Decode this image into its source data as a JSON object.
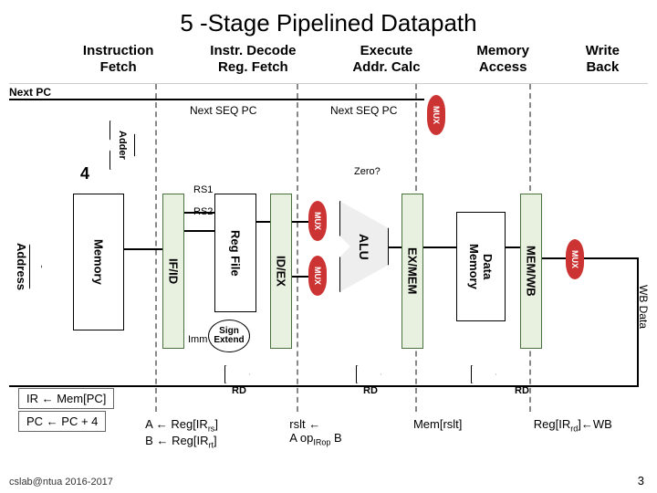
{
  "title": "5 -Stage Pipelined Datapath",
  "stages": {
    "if": "Instruction\nFetch",
    "id": "Instr. Decode\nReg. Fetch",
    "ex": "Execute\nAddr. Calc",
    "mem": "Memory\nAccess",
    "wb": "Write\nBack"
  },
  "labels": {
    "next_pc": "Next PC",
    "next_seq_pc": "Next SEQ PC",
    "adder": "Adder",
    "four": "4",
    "address": "Address",
    "memory": "Memory",
    "pipe_ifid": "IF/ID",
    "pipe_idex": "ID/EX",
    "pipe_exmem": "EX/MEM",
    "pipe_memwb": "MEM/WB",
    "rs1": "RS1",
    "rs2": "RS2",
    "regfile": "Reg File",
    "zero": "Zero?",
    "alu": "ALU",
    "mux": "MUX",
    "data_memory": "Data\nMemory",
    "sign_extend": "Sign\nExtend",
    "imm": "Imm",
    "rd": "RD",
    "wb_data": "WB Data"
  },
  "rtl": {
    "ir": "IR ← Mem[PC]",
    "pc": "PC ← PC + 4",
    "a": "A ← Reg[IR",
    "a_sub": "rs",
    "b": "B ← Reg[IR",
    "b_sub": "rt",
    "rslt": "rslt ←",
    "aop": "A op",
    "aop_sub": "IRop",
    "aop_b": " B",
    "memrslt": "Mem[rslt]",
    "regwb": "Reg[IR",
    "regwb_sub": "rd",
    "regwb_tail": "]←WB"
  },
  "footer": {
    "left": "cslab@ntua 2016-2017",
    "right": "3"
  }
}
